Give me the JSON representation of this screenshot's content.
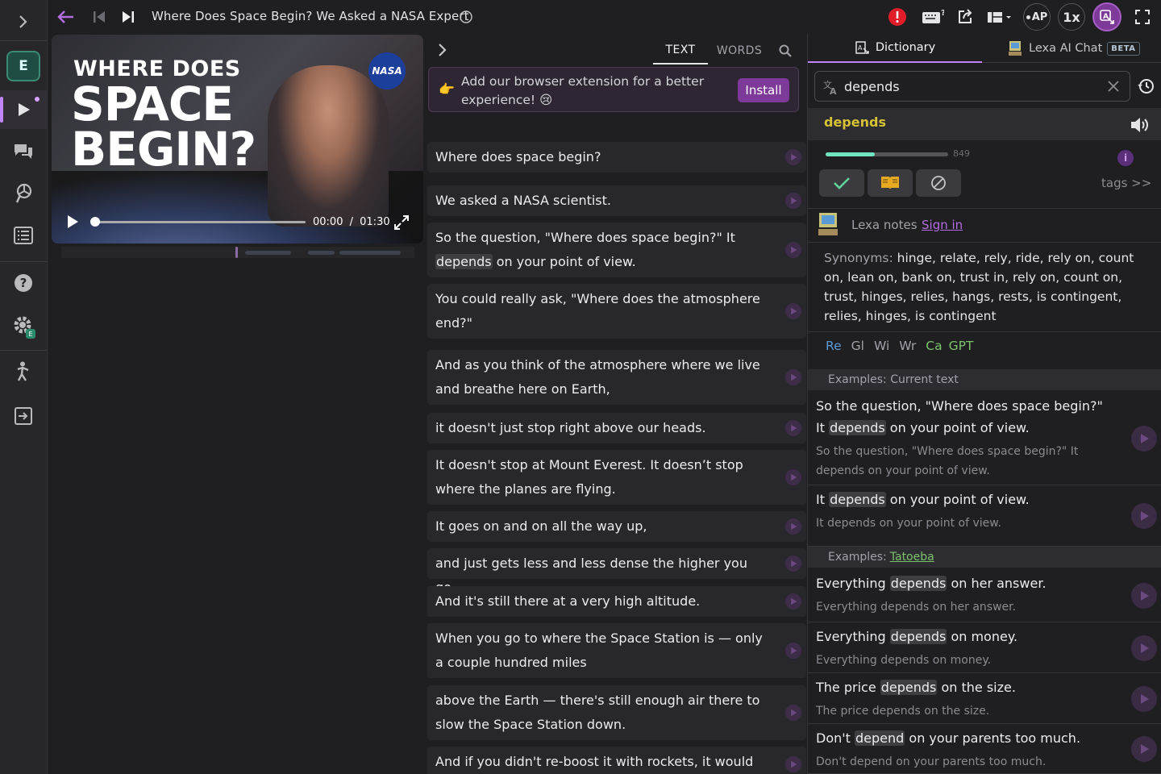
{
  "sidebar": {
    "badge_letter": "E",
    "settings_badge": "E"
  },
  "topbar": {
    "video_title": "Where Does Space Begin? We Asked a NASA Expert",
    "ap_label": "AP",
    "speed_label": "1x"
  },
  "video": {
    "overlay_line1": "WHERE DOES",
    "overlay_line2": "SPACE",
    "overlay_line3": "BEGIN?",
    "nasa_logo": "NASA",
    "time_current": "00:00",
    "time_separator": "/",
    "time_total": "01:30",
    "progress": 0.0
  },
  "subtitles": {
    "tab_text": "TEXT",
    "tab_words": "WORDS",
    "extension_banner": "Add our browser extension for a better experience! 😢",
    "install_label": "Install",
    "sentences": [
      {
        "pre": "Where does space begin?",
        "hl": "",
        "post": ""
      },
      {
        "pre": "We asked a NASA scientist.",
        "hl": "",
        "post": ""
      },
      {
        "pre": "So the question, \"Where does space begin?\" It ",
        "hl": "depends",
        "post": " on your point of view."
      },
      {
        "pre": "You could really ask, \"Where does the atmosphere end?\"",
        "hl": "",
        "post": ""
      },
      {
        "pre": "And as you think of the atmosphere where we live and breathe here on Earth,",
        "hl": "",
        "post": ""
      },
      {
        "pre": "it doesn't just stop right above our heads.",
        "hl": "",
        "post": ""
      },
      {
        "pre": "It doesn't stop at Mount Everest. It doesn’t stop where the planes are flying.",
        "hl": "",
        "post": ""
      },
      {
        "pre": "It goes on and on all the way up,",
        "hl": "",
        "post": ""
      },
      {
        "pre": "and just gets less and less dense the higher you go.",
        "hl": "",
        "post": ""
      },
      {
        "pre": "And it's still there at a very high altitude.",
        "hl": "",
        "post": ""
      },
      {
        "pre": "When you go to where the Space Station is — only a couple hundred miles",
        "hl": "",
        "post": ""
      },
      {
        "pre": "above the Earth — there's still enough air there to slow the Space Station down.",
        "hl": "",
        "post": ""
      },
      {
        "pre": "And if you didn't re-boost it with rockets, it would",
        "hl": "",
        "post": ""
      }
    ]
  },
  "dictionary": {
    "tab_dictionary": "Dictionary",
    "tab_ai_chat": "Lexa AI Chat",
    "beta_label": "BETA",
    "search_value": "depends",
    "headword": "depends",
    "frequency_rank": "849",
    "frequency_fill": 0.4,
    "tags_link": "tags >>",
    "notes_label": "Lexa notes",
    "sign_in_label": "Sign in",
    "synonyms_label": "Synonyms:",
    "synonyms_text": "hinge, relate, rely, ride, rely on, count on, lean on, bank on, trust in, rely on, count on, trust, hinges, relies, hangs, rests, is contingent, relies, hinges, is contingent",
    "links": [
      {
        "label": "Re",
        "color": "#5b9bd5"
      },
      {
        "label": "Gl",
        "color": "#a1a1aa"
      },
      {
        "label": "Wi",
        "color": "#a1a1aa"
      },
      {
        "label": "Wr",
        "color": "#a1a1aa"
      },
      {
        "label": "Ca",
        "color": "#7cc36b"
      },
      {
        "label": "GPT",
        "color": "#7cc36b"
      }
    ],
    "examples_current_header": "Examples: Current text",
    "examples_current": [
      {
        "pre": "So the question, \"Where does space begin?\" It ",
        "hl": "depends",
        "post": " on your point of view.",
        "sub": "So the question, \"Where does space begin?\" It depends on your point of view."
      },
      {
        "pre": "It ",
        "hl": "depends",
        "post": " on your point of view.",
        "sub": "It depends on your point of view."
      }
    ],
    "examples_tatoeba_prefix": "Examples: ",
    "examples_tatoeba_link": "Tatoeba",
    "examples_tatoeba": [
      {
        "pre": "Everything ",
        "hl": "depends",
        "post": " on her answer.",
        "sub": "Everything depends on her answer."
      },
      {
        "pre": "Everything ",
        "hl": "depends",
        "post": " on money.",
        "sub": "Everything depends on money."
      },
      {
        "pre": "The price ",
        "hl": "depends",
        "post": " on the size.",
        "sub": "The price depends on the size."
      },
      {
        "pre": "Don't ",
        "hl": "depend",
        "post": " on your parents too much.",
        "sub": "Don't depend on your parents too much."
      }
    ]
  },
  "colors": {
    "accent_purple": "#c084fc",
    "headword_yellow": "#d7c236",
    "freq_green": "#6fe3c2",
    "install_purple": "#7e3a99",
    "alert_red": "#e11d2a"
  }
}
